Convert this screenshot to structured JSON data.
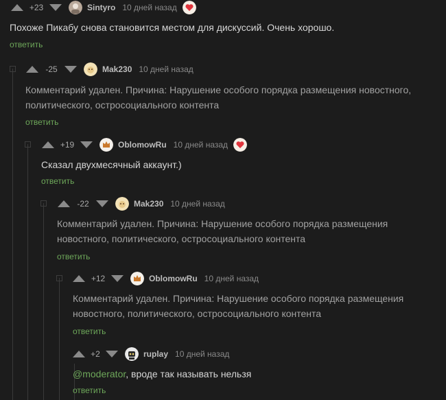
{
  "comments": [
    {
      "rating": "+23",
      "username": "Sintyro",
      "time": "10 дней назад",
      "text": "Похоже Пикабу снова становится местом для дискуссий. Очень хорошо.",
      "reply": "ответить",
      "avatar_icon": "sintyro-avatar-icon",
      "badge_icon": "heart-badge-icon"
    },
    {
      "rating": "-25",
      "username": "Mak230",
      "time": "10 дней назад",
      "text": "Комментарий удален. Причина: Нарушение особого порядка размещения новостного, политического, остросоциального контента",
      "reply": "ответить",
      "avatar_icon": "mak230-avatar-icon"
    },
    {
      "rating": "+19",
      "username": "OblomowRu",
      "time": "10 дней назад",
      "text": "Сказал двухмесячный аккаунт.)",
      "reply": "ответить",
      "avatar_icon": "oblomowru-avatar-icon",
      "badge_icon": "heart-badge-icon"
    },
    {
      "rating": "-22",
      "username": "Mak230",
      "time": "10 дней назад",
      "text": "Комментарий удален. Причина: Нарушение особого порядка размещения новостного, политического, остросоциального контента",
      "reply": "ответить",
      "avatar_icon": "mak230-avatar-icon"
    },
    {
      "rating": "+12",
      "username": "OblomowRu",
      "time": "10 дней назад",
      "text": "Комментарий удален. Причина: Нарушение особого порядка размещения новостного, политического, остросоциального контента",
      "reply": "ответить",
      "avatar_icon": "oblomowru-avatar-icon"
    },
    {
      "rating": "+2",
      "username": "ruplay",
      "time": "10 дней назад",
      "mention": "@moderator",
      "text": ", вроде так называть нельзя",
      "reply": "ответить",
      "avatar_icon": "ruplay-avatar-icon"
    }
  ],
  "colors": {
    "background": "#1c1c1c",
    "reply_link": "#6ea85a",
    "thread_line": "#3a3a3a"
  }
}
